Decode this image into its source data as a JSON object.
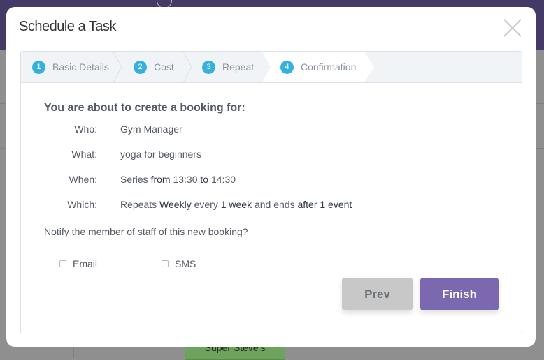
{
  "dialog": {
    "title": "Schedule a Task"
  },
  "steps": [
    {
      "num": "1",
      "label": "Basic Details"
    },
    {
      "num": "2",
      "label": "Cost"
    },
    {
      "num": "3",
      "label": "Repeat"
    },
    {
      "num": "4",
      "label": "Confirmation",
      "active": true
    }
  ],
  "summary": {
    "heading": "You are about to create a booking for:",
    "who": {
      "label": "Who:",
      "value": "Gym Manager"
    },
    "what": {
      "label": "What:",
      "value": "yoga for beginners"
    },
    "when": {
      "label": "When:",
      "p1": "Series",
      "p2": "from",
      "p3": "13:30",
      "p4": "to",
      "p5": "14:30"
    },
    "which": {
      "label": "Which:",
      "p1": "Repeats",
      "p2": "Weekly",
      "p3": "every",
      "p4": "1 week",
      "p5": "and ends",
      "p6": "after 1 event"
    }
  },
  "notify": {
    "question": "Notify the member of staff of this new booking?",
    "email": "Email",
    "sms": "SMS",
    "email_checked": false,
    "sms_checked": false
  },
  "buttons": {
    "prev": "Prev",
    "finish": "Finish"
  },
  "background": {
    "event": "Super Steve's"
  },
  "colors": {
    "accent": "#7c67b1",
    "step": "#36b0dd",
    "header": "#453a66"
  }
}
